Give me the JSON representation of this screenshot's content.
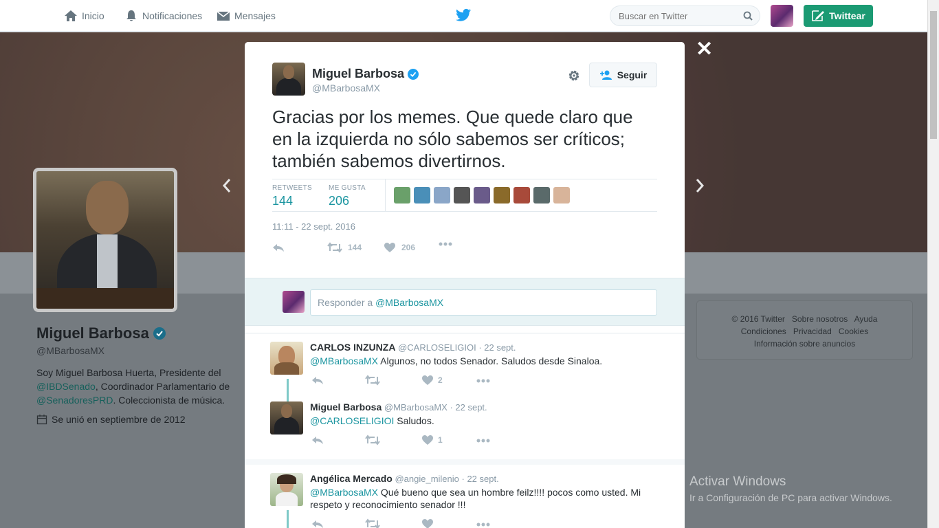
{
  "topnav": {
    "home": "Inicio",
    "notifications": "Notificaciones",
    "messages": "Mensajes",
    "search_placeholder": "Buscar en Twitter",
    "tweet_button": "Twittear"
  },
  "profile": {
    "name": "Miguel Barbosa",
    "handle": "@MBarbosaMX",
    "bio_1": "Soy Miguel Barbosa Huerta, Presidente del ",
    "bio_link1": "@IBDSenado",
    "bio_2": ", Coordinador Parlamentario de ",
    "bio_link2": "@SenadoresPRD",
    "bio_3": ". Coleccionista de música.",
    "joined": "Se unió en septiembre de 2012"
  },
  "footer": {
    "copyright": "© 2016 Twitter",
    "about": "Sobre nosotros",
    "help": "Ayuda",
    "terms": "Condiciones",
    "privacy": "Privacidad",
    "cookies": "Cookies",
    "ads_info": "Información sobre anuncios"
  },
  "windows": {
    "title": "Activar Windows",
    "subtitle": "Ir a Configuración de PC para activar Windows."
  },
  "tweet": {
    "author_name": "Miguel Barbosa",
    "author_handle": "@MBarbosaMX",
    "follow_label": "Seguir",
    "text": "Gracias por los memes. Que quede claro que en la izquierda no sólo sabemos ser críticos; también sabemos divertirnos.",
    "retweets_label": "RETWEETS",
    "retweets": "144",
    "likes_label": "ME GUSTA",
    "likes": "206",
    "timestamp": "11:11 - 22 sept. 2016",
    "action_retweets": "144",
    "action_likes": "206",
    "liker_colors": [
      "#6aa06a",
      "#4a8fb8",
      "#8aa6c8",
      "#555555",
      "#6a5b8a",
      "#8a6a2a",
      "#a84a3a",
      "#5a6a6a",
      "#d8b49a"
    ]
  },
  "reply_box": {
    "prefix": "Responder a ",
    "mention": "@MBarbosaMX"
  },
  "replies": [
    {
      "name": "CARLOS INZUNZA",
      "handle": "@CARLOSELIGIOI",
      "date": "· 22 sept.",
      "mention": "@MBarbosaMX",
      "text": " Algunos, no todos Senador. Saludos desde Sinaloa.",
      "likes": "2"
    },
    {
      "name": "Miguel Barbosa",
      "handle": "@MBarbosaMX",
      "date": "· 22 sept.",
      "mention": "@CARLOSELIGIOI",
      "text": " Saludos.",
      "likes": "1"
    },
    {
      "name": "Angélica Mercado",
      "handle": "@angie_milenio",
      "date": "· 22 sept.",
      "mention": "@MBarbosaMX",
      "text": " Qué bueno que sea un hombre feilz!!!! pocos como usted. Mi respeto y reconocimiento senador !!!",
      "likes": ""
    }
  ]
}
